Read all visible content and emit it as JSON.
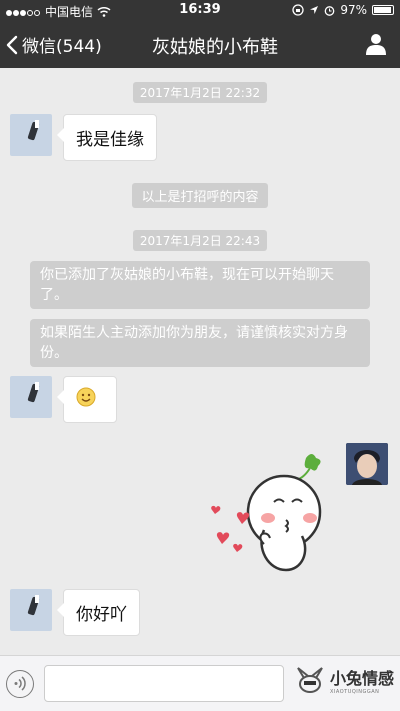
{
  "status_bar": {
    "carrier": "中国电信",
    "time": "16:39",
    "battery": "97%"
  },
  "nav": {
    "back_label": "微信(544)",
    "title": "灰姑娘的小布鞋"
  },
  "messages": {
    "time1": "2017年1月2日 22:32",
    "msg1": "我是佳缘",
    "greeting_note": "以上是打招呼的内容",
    "time2": "2017年1月2日 22:43",
    "sys1": "你已添加了灰姑娘的小布鞋，现在可以开始聊天了。",
    "sys2": "如果陌生人主动添加你为朋友，请谨慎核实对方身份。",
    "msg3": "你好吖"
  },
  "watermark": {
    "title": "小兔情感",
    "subtitle": "XIAOTUQINGGAN"
  },
  "icons": {
    "signal": "signal-dots-icon",
    "wifi": "wifi-icon",
    "lock": "rotation-lock-icon",
    "location": "location-arrow-icon",
    "alarm": "alarm-icon",
    "battery": "battery-icon",
    "back": "chevron-left-icon",
    "profile": "person-icon",
    "voice": "voice-icon",
    "emoji": "smile-emoji",
    "sticker": "blowing-kiss-sticker"
  },
  "colors": {
    "nav_bg": "#353535",
    "chat_bg": "#ebebeb",
    "system_pill": "#cecece"
  }
}
